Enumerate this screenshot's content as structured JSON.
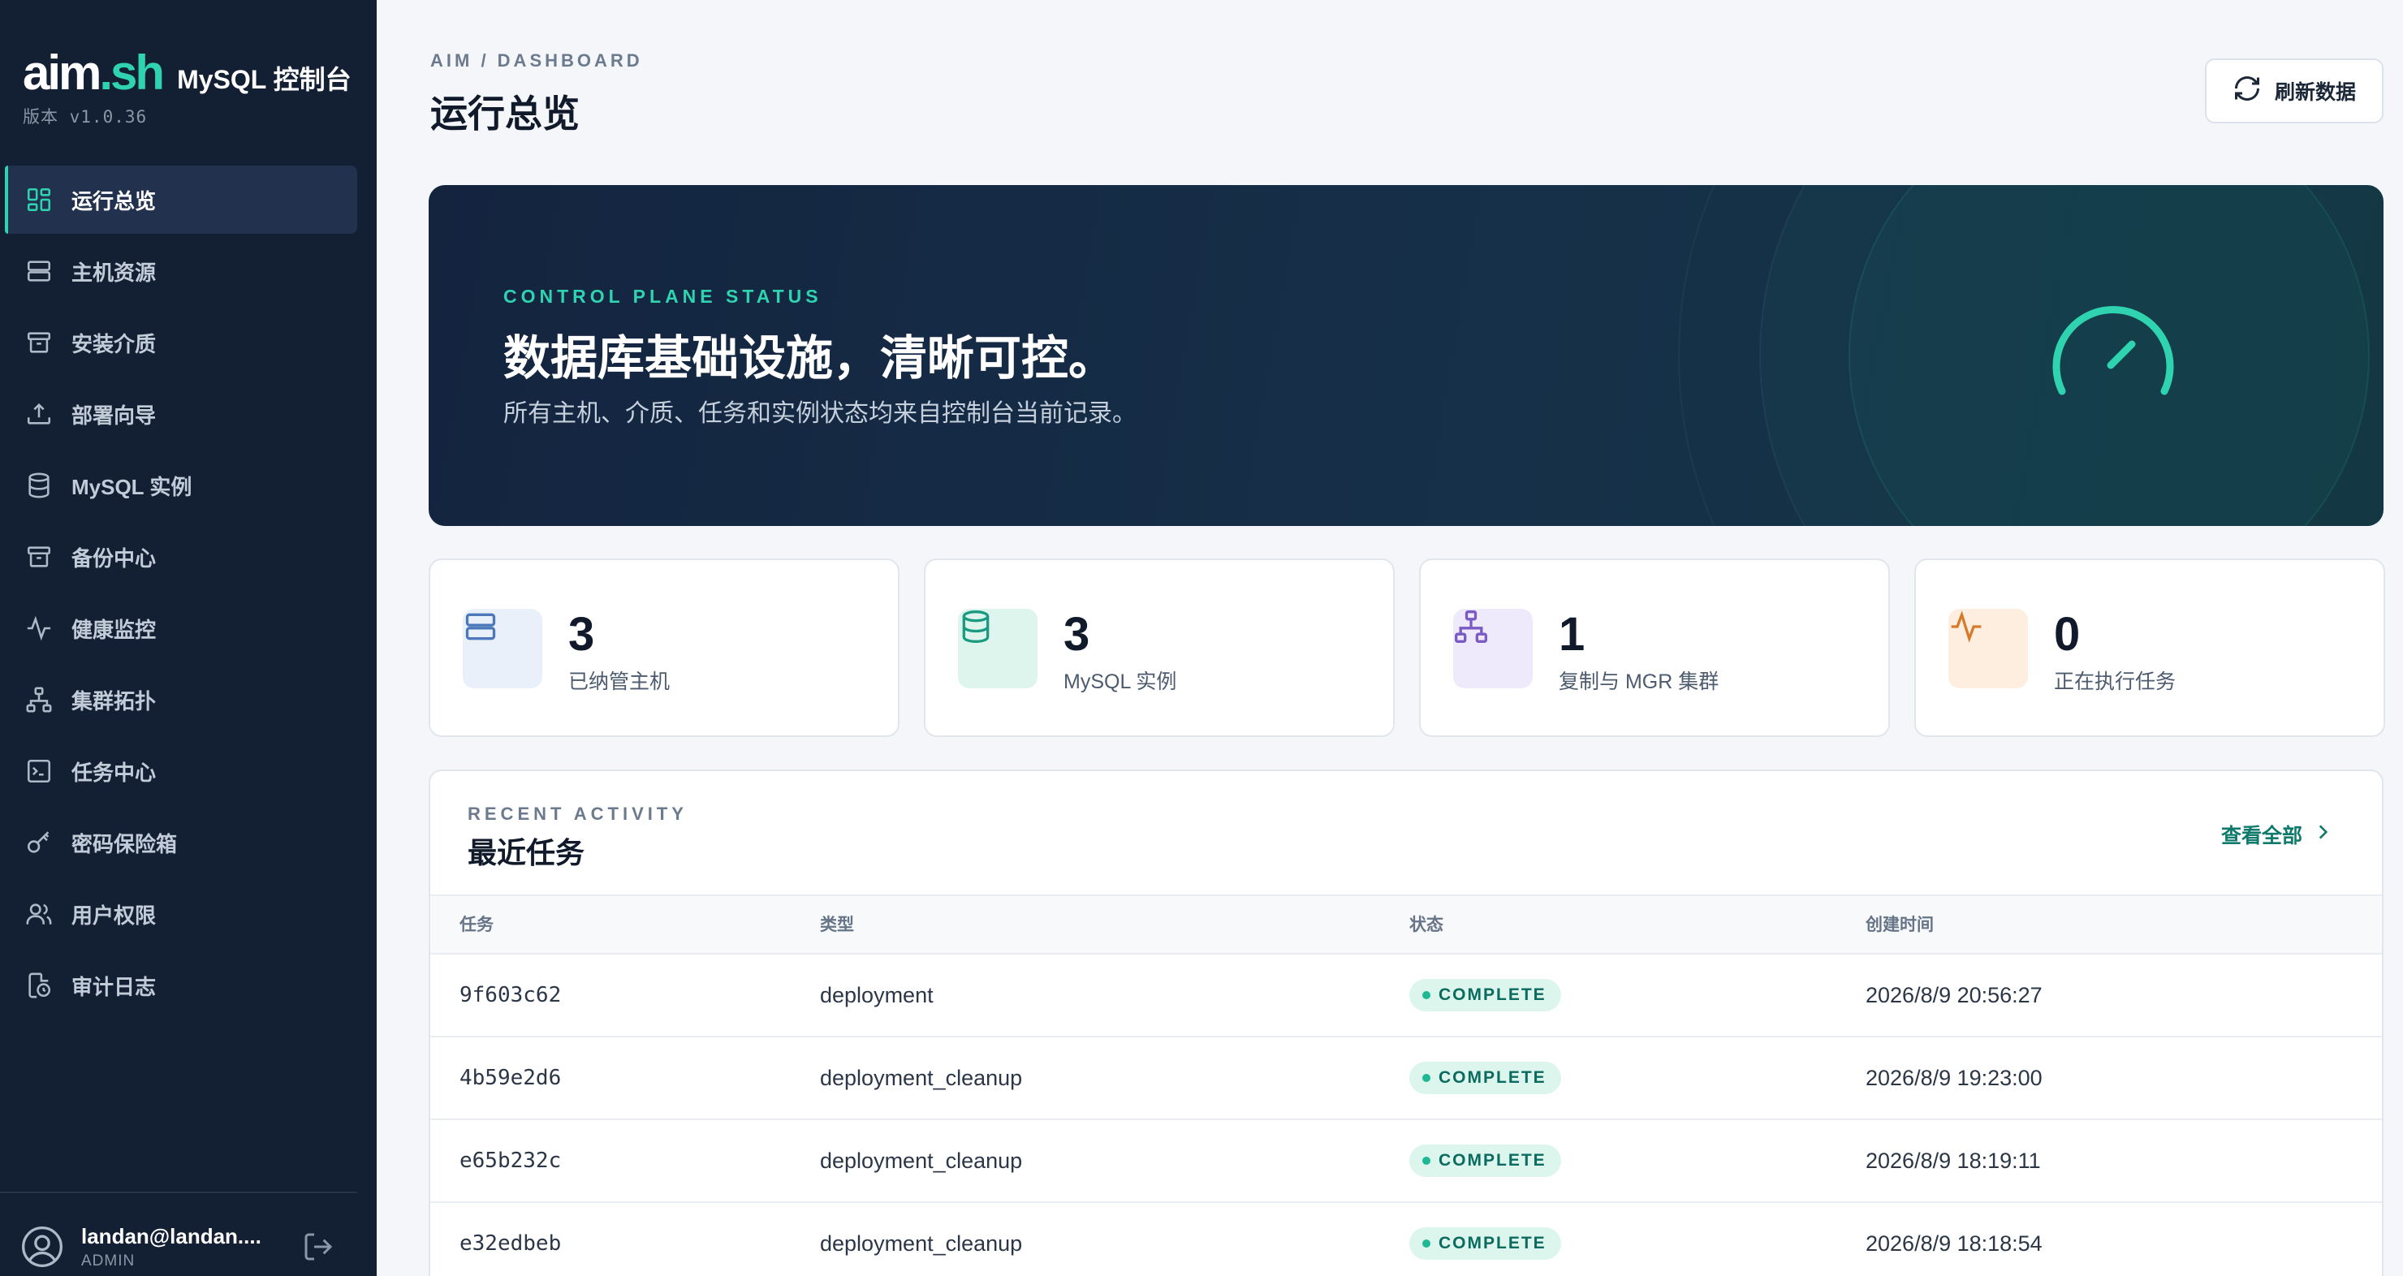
{
  "brand": {
    "logo": "aim.sh",
    "logo_main": "aim",
    "logo_dot": ".sh",
    "title": "MySQL 控制台",
    "version": "版本 v1.0.36"
  },
  "sidebar": {
    "items": [
      {
        "label": "运行总览",
        "icon": "dashboard-grid-icon",
        "active": true
      },
      {
        "label": "主机资源",
        "icon": "server-icon"
      },
      {
        "label": "安装介质",
        "icon": "archive-box-icon"
      },
      {
        "label": "部署向导",
        "icon": "upload-tray-icon"
      },
      {
        "label": "MySQL 实例",
        "icon": "database-icon"
      },
      {
        "label": "备份中心",
        "icon": "archive-box-icon"
      },
      {
        "label": "健康监控",
        "icon": "pulse-icon"
      },
      {
        "label": "集群拓扑",
        "icon": "topology-icon"
      },
      {
        "label": "任务中心",
        "icon": "terminal-icon"
      },
      {
        "label": "密码保险箱",
        "icon": "key-icon"
      },
      {
        "label": "用户权限",
        "icon": "users-icon"
      },
      {
        "label": "审计日志",
        "icon": "audit-clock-icon"
      }
    ],
    "user": {
      "name": "landan@landan....",
      "role": "ADMIN"
    }
  },
  "header": {
    "breadcrumb": "AIM / DASHBOARD",
    "title": "运行总览",
    "refresh_label": "刷新数据"
  },
  "hero": {
    "eyebrow": "CONTROL PLANE STATUS",
    "title": "数据库基础设施，清晰可控。",
    "subtitle": "所有主机、介质、任务和实例状态均来自控制台当前记录。"
  },
  "stats": [
    {
      "value": "3",
      "label": "已纳管主机",
      "icon": "server-icon",
      "bg": "#e9f0fa",
      "fg": "#4a78b8"
    },
    {
      "value": "3",
      "label": "MySQL 实例",
      "icon": "database-icon",
      "bg": "#def5ee",
      "fg": "#1a9a80"
    },
    {
      "value": "1",
      "label": "复制与 MGR 集群",
      "icon": "topology-icon",
      "bg": "#efeafb",
      "fg": "#7a5bc4"
    },
    {
      "value": "0",
      "label": "正在执行任务",
      "icon": "pulse-icon",
      "bg": "#fdeee0",
      "fg": "#d77a2a"
    }
  ],
  "activity": {
    "eyebrow": "RECENT ACTIVITY",
    "title": "最近任务",
    "view_all": "查看全部",
    "columns": [
      "任务",
      "类型",
      "状态",
      "创建时间"
    ],
    "rows": [
      {
        "id": "9f603c62",
        "type": "deployment",
        "status": "COMPLETE",
        "created": "2026/8/9 20:56:27"
      },
      {
        "id": "4b59e2d6",
        "type": "deployment_cleanup",
        "status": "COMPLETE",
        "created": "2026/8/9 19:23:00"
      },
      {
        "id": "e65b232c",
        "type": "deployment_cleanup",
        "status": "COMPLETE",
        "created": "2026/8/9 18:19:11"
      },
      {
        "id": "e32edbeb",
        "type": "deployment_cleanup",
        "status": "COMPLETE",
        "created": "2026/8/9 18:18:54"
      }
    ]
  },
  "colors": {
    "accent": "#2fd3b0",
    "sidebar_bg": "#131f33",
    "page_bg": "#f4f6f9",
    "badge_bg": "#dcf6ee",
    "badge_fg": "#0b6b5e"
  }
}
